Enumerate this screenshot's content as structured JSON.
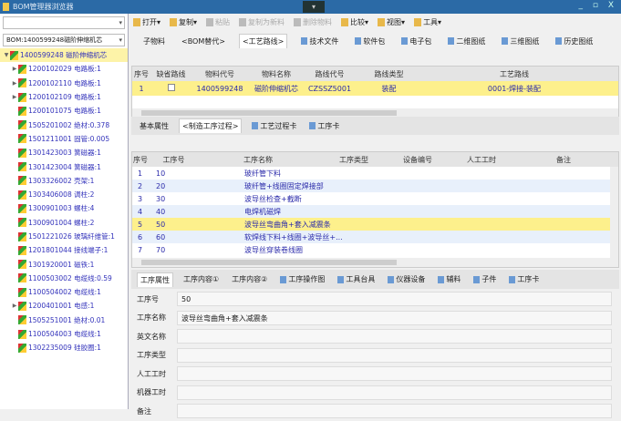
{
  "title": "BOM管理器浏览器",
  "title_center": "▾",
  "toolbar": {
    "search": "",
    "items": [
      {
        "label": "打开▾",
        "enabled": true
      },
      {
        "label": "复制▾",
        "enabled": true
      },
      {
        "label": "粘贴",
        "enabled": false
      },
      {
        "label": "复制为新料",
        "enabled": false
      },
      {
        "label": "删除物料",
        "enabled": false
      },
      {
        "label": "比较▾",
        "enabled": true
      },
      {
        "label": "视图▾",
        "enabled": true
      },
      {
        "label": "工具▾",
        "enabled": true
      }
    ]
  },
  "bom_selector": "BOM:1400599248磁阶伸缩机芯",
  "tree": [
    {
      "label": "1400599248 磁阶伸缩机芯",
      "expanded": true,
      "root": true
    },
    {
      "label": "1200102029 电路板:1",
      "exp": true
    },
    {
      "label": "1200102110 电路板:1",
      "exp": true
    },
    {
      "label": "1200102109 电路板:1",
      "exp": true
    },
    {
      "label": "1200101075 电路板:1"
    },
    {
      "label": "1505201002 绝材:0.378"
    },
    {
      "label": "1501211001 固管:0.005"
    },
    {
      "label": "1301423003 簧磁器:1"
    },
    {
      "label": "1301423004 簧磁器:1"
    },
    {
      "label": "1303326002 壳架:1"
    },
    {
      "label": "1303406008 调柱:2"
    },
    {
      "label": "1300901003 螺柱:4"
    },
    {
      "label": "1300901004 螺柱:2"
    },
    {
      "label": "1501221026 玻璃纤维管:1"
    },
    {
      "label": "1201801044 接线端子:1"
    },
    {
      "label": "1301920001 磁铁:1"
    },
    {
      "label": "1100503002 电缆线:0.59"
    },
    {
      "label": "1100504002 电缆线:1"
    },
    {
      "label": "1200401001 电感:1",
      "exp": true
    },
    {
      "label": "1505251001 绝材:0.01"
    },
    {
      "label": "1100504003 电缆线:1"
    },
    {
      "label": "1302235009 硅胶圈:1"
    }
  ],
  "tabs": [
    "子物料",
    "<BOM替代>",
    "<工艺路线>",
    "技术文件",
    "软件包",
    "电子包",
    "二维图纸",
    "三维图纸",
    "历史图纸"
  ],
  "route_table": {
    "headers": [
      "序号",
      "缺省路线",
      "物料代号",
      "物料名称",
      "路线代号",
      "路线类型",
      "工艺路线"
    ],
    "rows": [
      {
        "no": "1",
        "default": false,
        "code": "1400599248",
        "name": "磁阶伸缩机芯",
        "route_code": "CZSSZ5001",
        "route_type": "装配",
        "route": "0001-焊接-装配"
      }
    ]
  },
  "subtabs": [
    "基本属性",
    "<制造工序过程>",
    "工艺过程卡",
    "工序卡"
  ],
  "process_table": {
    "headers": [
      "序号",
      "工序号",
      "工序名称",
      "工序类型",
      "设备编号",
      "人工工时",
      "备注"
    ],
    "rows": [
      {
        "no": "1",
        "op": "10",
        "name": "玻纤管下料"
      },
      {
        "no": "2",
        "op": "20",
        "name": "玻纤管+线圈固定焊接部"
      },
      {
        "no": "3",
        "op": "30",
        "name": "波导丝检查+截断"
      },
      {
        "no": "4",
        "op": "40",
        "name": "电焊机磁焊"
      },
      {
        "no": "5",
        "op": "50",
        "name": "波导丝弯曲角+套入减震条"
      },
      {
        "no": "6",
        "op": "60",
        "name": "软焊线下料+线圈+波导丝+..."
      },
      {
        "no": "7",
        "op": "70",
        "name": "波导丝穿装卷线圈"
      }
    ]
  },
  "detail_tabs": [
    "工序属性",
    "工序内容①",
    "工序内容②",
    "工序操作图",
    "工具台具",
    "仪器设备",
    "辅料",
    "子件",
    "工序卡"
  ],
  "form": [
    {
      "label": "工序号",
      "value": "50"
    },
    {
      "label": "工序名称",
      "value": "波导丝弯曲角+套入减震条"
    },
    {
      "label": "英文名称",
      "value": ""
    },
    {
      "label": "工序类型",
      "value": ""
    },
    {
      "label": "人工工时",
      "value": ""
    },
    {
      "label": "机器工时",
      "value": ""
    },
    {
      "label": "备注",
      "value": ""
    }
  ]
}
